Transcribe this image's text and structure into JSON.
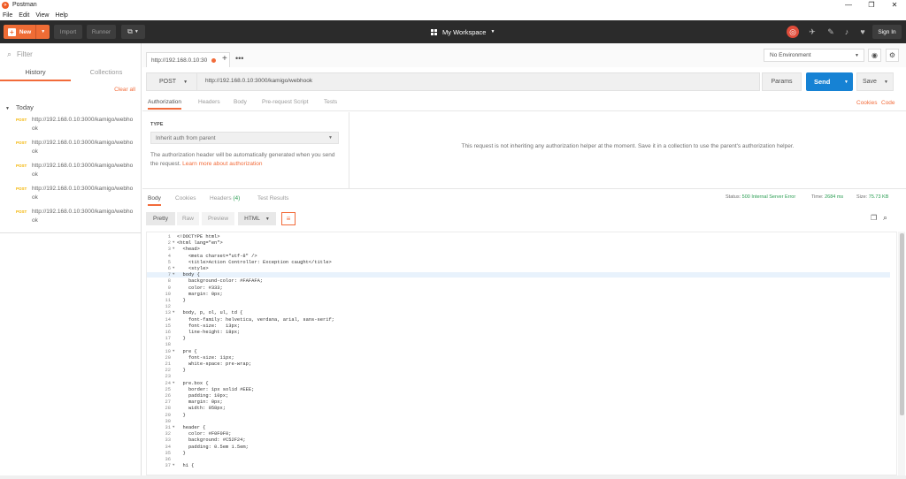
{
  "window": {
    "title": "Postman",
    "controls": [
      "—",
      "❐",
      "✕"
    ]
  },
  "menu": [
    "File",
    "Edit",
    "View",
    "Help"
  ],
  "toolbar": {
    "new_label": "New",
    "import_label": "Import",
    "runner_label": "Runner",
    "workspace_label": "My Workspace",
    "signin_label": "Sign In"
  },
  "sidebar": {
    "search_placeholder": "Filter",
    "tabs": [
      "History",
      "Collections"
    ],
    "clear_all": "Clear all",
    "group": "Today",
    "items": [
      {
        "method": "POST",
        "url": "http://192.168.0.10:3000/kamigo/webhook"
      },
      {
        "method": "POST",
        "url": "http://192.168.0.10:3000/kamigo/webhook"
      },
      {
        "method": "POST",
        "url": "http://192.168.0.10:3000/kamigo/webhook"
      },
      {
        "method": "POST",
        "url": "http://192.168.0.10:3000/kamigo/webhook"
      },
      {
        "method": "POST",
        "url": "http://192.168.0.10:3000/kamigo/webhook"
      }
    ]
  },
  "request_tab": {
    "label": "http://192.168.0.10:30"
  },
  "environment": {
    "selected": "No Environment"
  },
  "request": {
    "method": "POST",
    "url": "http://192.168.0.10:3000/kamigo/webhook",
    "params_label": "Params",
    "send_label": "Send",
    "save_label": "Save"
  },
  "request_tabs": [
    "Authorization",
    "Headers",
    "Body",
    "Pre-request Script",
    "Tests"
  ],
  "request_links": {
    "cookies": "Cookies",
    "code": "Code"
  },
  "auth": {
    "type_label": "TYPE",
    "type_value": "Inherit auth from parent",
    "help_text": "The authorization header will be automatically generated when you send the request.",
    "help_link": "Learn more about authorization",
    "message": "This request is not inheriting any authorization helper at the moment. Save it in a collection to use the parent's authorization helper."
  },
  "response": {
    "tabs": [
      {
        "label": "Body",
        "badge": ""
      },
      {
        "label": "Cookies",
        "badge": ""
      },
      {
        "label": "Headers",
        "badge": "(4)"
      },
      {
        "label": "Test Results",
        "badge": ""
      }
    ],
    "status_label": "Status:",
    "status_value": "500 Internal Server Error",
    "time_label": "Time:",
    "time_value": "2684 ms",
    "size_label": "Size:",
    "size_value": "75.73 KB",
    "format_buttons": [
      "Pretty",
      "Raw",
      "Preview"
    ],
    "language": "HTML",
    "highlighted_line": 7,
    "lines": [
      {
        "n": "1",
        "fold": false,
        "text": "<!DOCTYPE html>"
      },
      {
        "n": "2",
        "fold": true,
        "text": "<html lang=\"en\">"
      },
      {
        "n": "3",
        "fold": true,
        "text": "  <head>"
      },
      {
        "n": "4",
        "fold": false,
        "text": "    <meta charset=\"utf-8\" />"
      },
      {
        "n": "5",
        "fold": false,
        "text": "    <title>Action Controller: Exception caught</title>"
      },
      {
        "n": "6",
        "fold": true,
        "text": "    <style>"
      },
      {
        "n": "7",
        "fold": true,
        "text": "  body {"
      },
      {
        "n": "8",
        "fold": false,
        "text": "    background-color: #FAFAFA;"
      },
      {
        "n": "9",
        "fold": false,
        "text": "    color: #333;"
      },
      {
        "n": "10",
        "fold": false,
        "text": "    margin: 0px;"
      },
      {
        "n": "11",
        "fold": false,
        "text": "  }"
      },
      {
        "n": "12",
        "fold": false,
        "text": ""
      },
      {
        "n": "13",
        "fold": true,
        "text": "  body, p, ol, ul, td {"
      },
      {
        "n": "14",
        "fold": false,
        "text": "    font-family: helvetica, verdana, arial, sans-serif;"
      },
      {
        "n": "15",
        "fold": false,
        "text": "    font-size:   13px;"
      },
      {
        "n": "16",
        "fold": false,
        "text": "    line-height: 18px;"
      },
      {
        "n": "17",
        "fold": false,
        "text": "  }"
      },
      {
        "n": "18",
        "fold": false,
        "text": ""
      },
      {
        "n": "19",
        "fold": true,
        "text": "  pre {"
      },
      {
        "n": "20",
        "fold": false,
        "text": "    font-size: 11px;"
      },
      {
        "n": "21",
        "fold": false,
        "text": "    white-space: pre-wrap;"
      },
      {
        "n": "22",
        "fold": false,
        "text": "  }"
      },
      {
        "n": "23",
        "fold": false,
        "text": ""
      },
      {
        "n": "24",
        "fold": true,
        "text": "  pre.box {"
      },
      {
        "n": "25",
        "fold": false,
        "text": "    border: 1px solid #EEE;"
      },
      {
        "n": "26",
        "fold": false,
        "text": "    padding: 10px;"
      },
      {
        "n": "27",
        "fold": false,
        "text": "    margin: 0px;"
      },
      {
        "n": "28",
        "fold": false,
        "text": "    width: 958px;"
      },
      {
        "n": "29",
        "fold": false,
        "text": "  }"
      },
      {
        "n": "30",
        "fold": false,
        "text": ""
      },
      {
        "n": "31",
        "fold": true,
        "text": "  header {"
      },
      {
        "n": "32",
        "fold": false,
        "text": "    color: #F0F0F0;"
      },
      {
        "n": "33",
        "fold": false,
        "text": "    background: #C52F24;"
      },
      {
        "n": "34",
        "fold": false,
        "text": "    padding: 0.5em 1.5em;"
      },
      {
        "n": "35",
        "fold": false,
        "text": "  }"
      },
      {
        "n": "36",
        "fold": false,
        "text": ""
      },
      {
        "n": "37",
        "fold": true,
        "text": "  h1 {"
      }
    ]
  },
  "colors": {
    "accent": "#f26b3a",
    "send": "#1682d4",
    "toolbar": "#2b2b2b",
    "status_ok": "#2a9d52",
    "post": "#f4b400"
  }
}
